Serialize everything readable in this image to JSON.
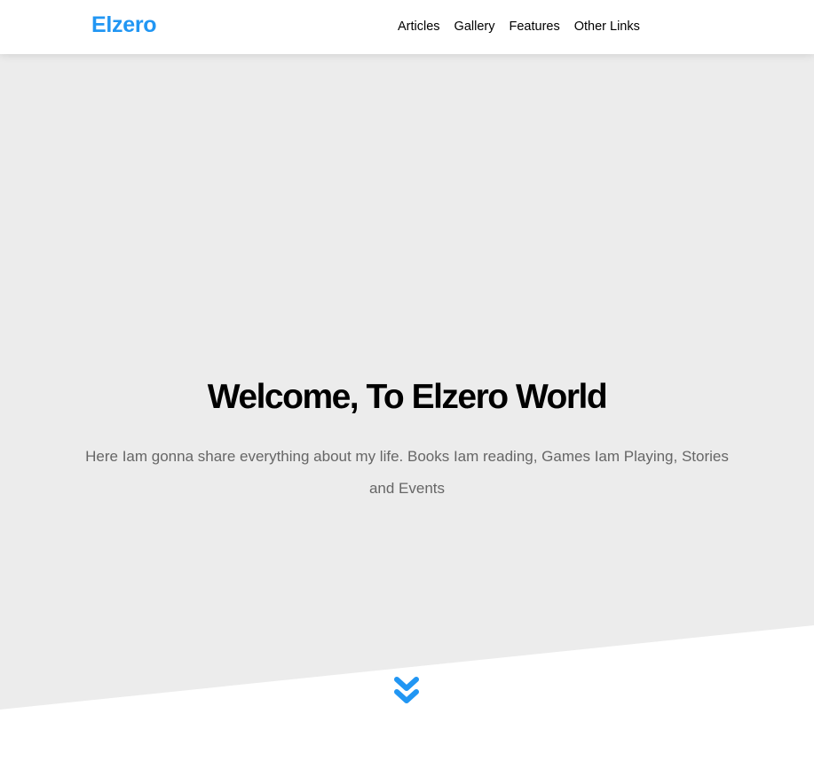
{
  "header": {
    "logo": "Elzero",
    "nav": [
      {
        "label": "Articles"
      },
      {
        "label": "Gallery"
      },
      {
        "label": "Features"
      },
      {
        "label": "Other Links"
      }
    ]
  },
  "landing": {
    "title": "Welcome, To Elzero World",
    "text": "Here Iam gonna share everything about my life. Books Iam reading, Games Iam Playing, Stories and Events",
    "go_down_icon": "double-chevron-down-icon"
  },
  "colors": {
    "accent": "#2196f3",
    "landing_bg": "#ececec",
    "text_muted": "#666666",
    "header_bg": "#ffffff"
  }
}
